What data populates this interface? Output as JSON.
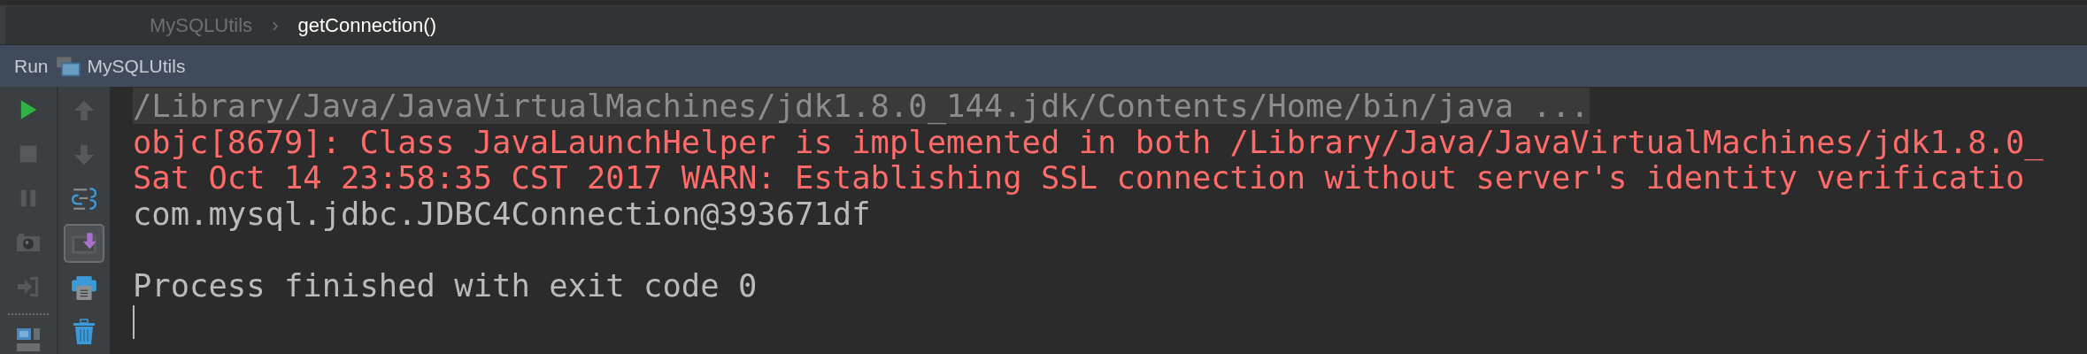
{
  "breadcrumb": {
    "items": [
      {
        "label": "MySQLUtils",
        "selected": false
      },
      {
        "label": "getConnection()",
        "selected": true
      }
    ],
    "separator": "›"
  },
  "run_panel": {
    "label": "Run",
    "config": "MySQLUtils"
  },
  "toolbar": {
    "scroll_to_end": {
      "on": true
    }
  },
  "console": {
    "lines": [
      {
        "kind": "command",
        "text": "/Library/Java/JavaVirtualMachines/jdk1.8.0_144.jdk/Contents/Home/bin/java ..."
      },
      {
        "kind": "error",
        "text": "objc[8679]: Class JavaLaunchHelper is implemented in both /Library/Java/JavaVirtualMachines/jdk1.8.0_"
      },
      {
        "kind": "error",
        "text": "Sat Oct 14 23:58:35 CST 2017 WARN: Establishing SSL connection without server's identity verificatio"
      },
      {
        "kind": "output",
        "text": "com.mysql.jdbc.JDBC4Connection@393671df"
      },
      {
        "kind": "blank"
      },
      {
        "kind": "output",
        "text": "Process finished with exit code 0"
      }
    ]
  }
}
